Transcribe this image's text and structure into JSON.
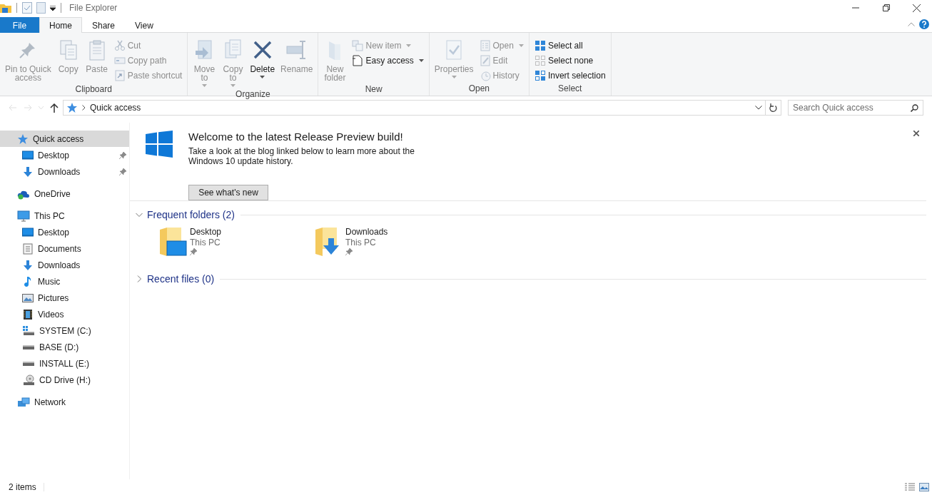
{
  "window": {
    "title": "File Explorer"
  },
  "ribbon_tabs": [
    {
      "label": "File",
      "kind": "file",
      "selected": false
    },
    {
      "label": "Home",
      "kind": "tab",
      "selected": true
    },
    {
      "label": "Share",
      "kind": "tab",
      "selected": false
    },
    {
      "label": "View",
      "kind": "tab",
      "selected": false
    }
  ],
  "ribbon": {
    "groups": [
      {
        "label": "Clipboard",
        "columns": [
          {
            "kind": "large",
            "label_lines": [
              "Pin to Quick",
              "access"
            ],
            "disabled": true
          },
          {
            "kind": "large",
            "label_lines": [
              "Copy"
            ],
            "disabled": true
          },
          {
            "kind": "large",
            "label_lines": [
              "Paste"
            ],
            "disabled": true
          },
          {
            "kind": "small",
            "items": [
              {
                "label": "Cut",
                "disabled": true
              },
              {
                "label": "Copy path",
                "disabled": true
              },
              {
                "label": "Paste shortcut",
                "disabled": true
              }
            ]
          }
        ]
      },
      {
        "label": "Organize",
        "columns": [
          {
            "kind": "large",
            "label_lines": [
              "Move",
              "to"
            ],
            "disabled": true,
            "dropdown": true
          },
          {
            "kind": "large",
            "label_lines": [
              "Copy",
              "to"
            ],
            "disabled": true,
            "dropdown": true
          },
          {
            "kind": "large",
            "label_lines": [
              "Delete"
            ],
            "disabled": false,
            "dropdown": true
          },
          {
            "kind": "large",
            "label_lines": [
              "Rename"
            ],
            "disabled": true
          }
        ]
      },
      {
        "label": "New",
        "columns": [
          {
            "kind": "large",
            "label_lines": [
              "New",
              "folder"
            ],
            "disabled": true
          },
          {
            "kind": "small",
            "items": [
              {
                "label": "New item",
                "disabled": true,
                "dropdown": true
              },
              {
                "label": "Easy access",
                "disabled": false,
                "dropdown": true
              }
            ]
          }
        ]
      },
      {
        "label": "Open",
        "columns": [
          {
            "kind": "large",
            "label_lines": [
              "Properties"
            ],
            "disabled": true,
            "dropdown": true
          },
          {
            "kind": "small",
            "items": [
              {
                "label": "Open",
                "disabled": true,
                "dropdown": true
              },
              {
                "label": "Edit",
                "disabled": true
              },
              {
                "label": "History",
                "disabled": true
              }
            ]
          }
        ]
      },
      {
        "label": "Select",
        "columns": [
          {
            "kind": "small",
            "items": [
              {
                "label": "Select all",
                "disabled": false
              },
              {
                "label": "Select none",
                "disabled": false
              },
              {
                "label": "Invert selection",
                "disabled": false
              }
            ]
          }
        ]
      }
    ]
  },
  "nav_buttons": [
    {
      "kind": "back",
      "disabled": true
    },
    {
      "kind": "forward",
      "disabled": true
    },
    {
      "kind": "recent",
      "disabled": true
    },
    {
      "kind": "up",
      "disabled": false
    }
  ],
  "address": {
    "path": [
      "Quick access"
    ]
  },
  "search": {
    "placeholder": "Search Quick access"
  },
  "nav": [
    {
      "label": "Quick access",
      "selected": true,
      "children": [
        {
          "label": "Desktop",
          "selected": false,
          "pinned": true
        },
        {
          "label": "Downloads",
          "selected": false,
          "pinned": true
        }
      ]
    },
    {
      "label": "OneDrive",
      "selected": false
    },
    {
      "label": "This PC",
      "selected": false,
      "children": [
        {
          "label": "Desktop",
          "selected": false
        },
        {
          "label": "Documents",
          "selected": false
        },
        {
          "label": "Downloads",
          "selected": false
        },
        {
          "label": "Music",
          "selected": false
        },
        {
          "label": "Pictures",
          "selected": false
        },
        {
          "label": "Videos",
          "selected": false
        },
        {
          "label": "SYSTEM (C:)",
          "selected": false
        },
        {
          "label": "BASE (D:)",
          "selected": false
        },
        {
          "label": "INSTALL (E:)",
          "selected": false
        },
        {
          "label": "CD Drive (H:)",
          "selected": false
        }
      ]
    },
    {
      "label": "Network",
      "selected": false
    }
  ],
  "banner": {
    "title": "Welcome to the latest Release Preview build!",
    "text": "Take a look at the blog linked below to learn more about the Windows 10 update history.",
    "button": "See what's new"
  },
  "sections": [
    {
      "title": "Frequent folders (2)",
      "expanded": true,
      "items": [
        {
          "name": "Desktop",
          "location": "This PC",
          "pinned": true
        },
        {
          "name": "Downloads",
          "location": "This PC",
          "pinned": true
        }
      ]
    },
    {
      "title": "Recent files (0)",
      "expanded": false
    }
  ],
  "status_bar": {
    "count": "2 items"
  }
}
